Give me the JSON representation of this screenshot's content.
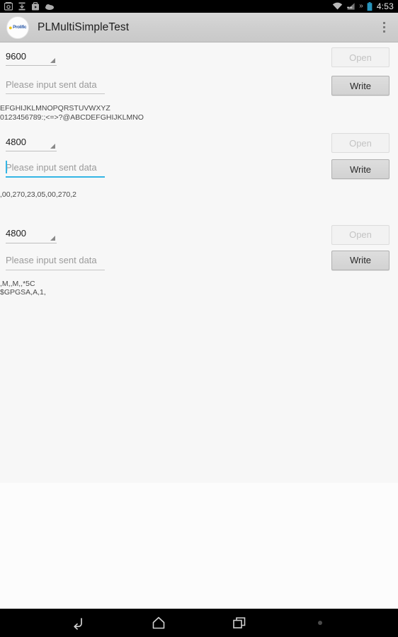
{
  "statusbar": {
    "time": "4:53",
    "left_icons": [
      "screenshot-icon",
      "download-icon",
      "app-icon",
      "cloud-icon"
    ],
    "right_icons": [
      "wifi-icon",
      "cellular-signal-icon",
      "more-icons-chevron",
      "battery-icon"
    ],
    "chevron": "»"
  },
  "appbar": {
    "logo_label": "Prolific",
    "title": "PLMultiSimpleTest",
    "overflow_label": "overflow-menu"
  },
  "ports": [
    {
      "baud": "9600",
      "input_placeholder": "Please input sent data",
      "input_value": "",
      "focused": false,
      "open_label": "Open",
      "open_enabled": false,
      "write_label": "Write",
      "write_enabled": true,
      "log": "EFGHIJKLMNOPQRSTUVWXYZ\n0123456789:;<=>?@ABCDEFGHIJKLMNO"
    },
    {
      "baud": "4800",
      "input_placeholder": "Please input sent data",
      "input_value": "",
      "focused": true,
      "open_label": "Open",
      "open_enabled": false,
      "write_label": "Write",
      "write_enabled": true,
      "log": ",00,270,23,05,00,270,2"
    },
    {
      "baud": "4800",
      "input_placeholder": "Please input sent data",
      "input_value": "",
      "focused": false,
      "open_label": "Open",
      "open_enabled": false,
      "write_label": "Write",
      "write_enabled": true,
      "log": ",M,,M,,*5C\n$GPGSA,A,1,"
    }
  ],
  "navbar": {
    "back_label": "Back",
    "home_label": "Home",
    "recents_label": "Recent apps",
    "dot_label": "menu-dot"
  },
  "colors": {
    "accent": "#33b5e5",
    "content_bg": "#f7f7f7",
    "actionbar_bg": "#cfcfcf",
    "system_bg": "#000000"
  }
}
